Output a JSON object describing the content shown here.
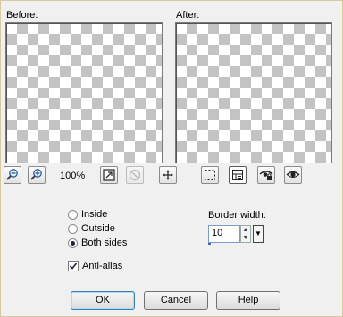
{
  "before_label": "Before:",
  "after_label": "After:",
  "zoom_level": "100%",
  "toolbar": {
    "zoom_out_icon": "zoom-out-icon",
    "zoom_in_icon": "zoom-in-icon",
    "fit_window_icon": "fit-window-icon",
    "preview_disabled_icon": "no-preview-icon",
    "move_icon": "move-icon",
    "selection_icon": "dashed-selection-icon",
    "layout_icon": "layout-toggle-icon",
    "lock_icon": "eye-lock-icon",
    "eye_icon": "eye-icon"
  },
  "placement": {
    "options": [
      "Inside",
      "Outside",
      "Both sides"
    ],
    "selected": "Both sides"
  },
  "border_width": {
    "label": "Border width:",
    "value": "10"
  },
  "anti_alias": {
    "label": "Anti-alias",
    "checked": true
  },
  "buttons": {
    "ok": "OK",
    "cancel": "Cancel",
    "help": "Help"
  },
  "colors": {
    "checker_dark": "#c3c3c3",
    "checker_light": "#ffffff",
    "default_button_border": "#3c7fb1"
  }
}
